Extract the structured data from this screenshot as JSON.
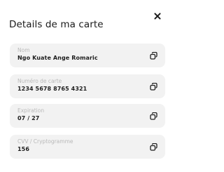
{
  "modal": {
    "title": "Details de ma carte"
  },
  "fields": [
    {
      "label": "Nom",
      "value": "Ngo Kuate Ange Romaric"
    },
    {
      "label": "Numéro de carte",
      "value": "1234  5678  8765  4321"
    },
    {
      "label": "Expiration",
      "value": "07 / 27"
    },
    {
      "label": "CVV / Cryptogramme",
      "value": "156"
    }
  ],
  "icons": {
    "close": "close-icon",
    "copy": "copy-icon"
  },
  "colors": {
    "field_background": "#f2f2f2",
    "label": "#b9b9b9",
    "value": "#1e1e1e"
  }
}
